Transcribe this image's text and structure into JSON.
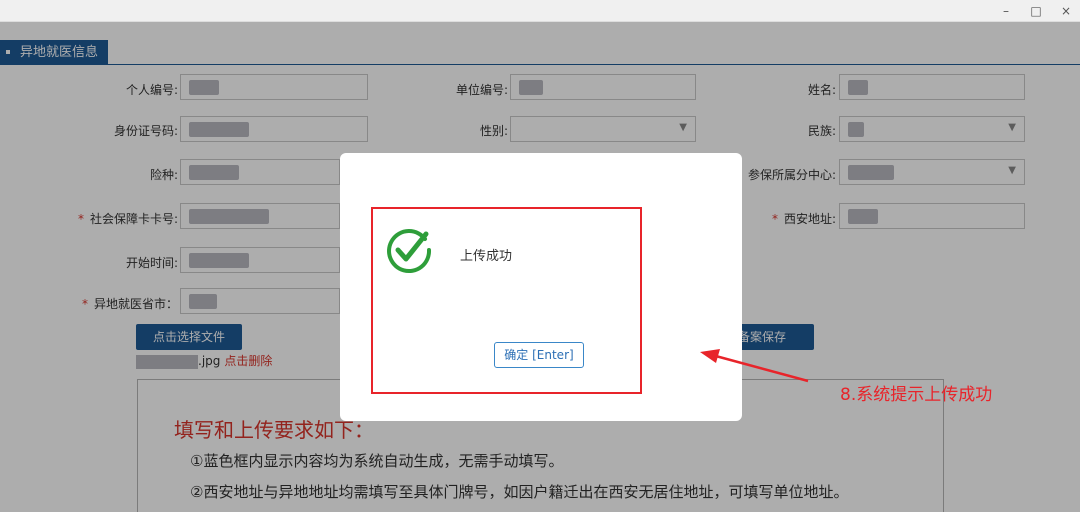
{
  "window": {
    "min": "–",
    "max": "□",
    "close": "×"
  },
  "section": {
    "title": "异地就医信息"
  },
  "form": {
    "personal_no": "个人编号:",
    "unit_no": "单位编号:",
    "name": "姓名:",
    "id_no": "身份证号码:",
    "gender": "性别:",
    "ethnicity": "民族:",
    "insurance_type": "险种:",
    "center": "参保所属分中心:",
    "ss_card": "社会保障卡卡号:",
    "xian_addr": "西安地址:",
    "start_time": "开始时间:",
    "remote_city": "异地就医省市：",
    "required_mark": "*"
  },
  "buttons": {
    "choose_file": "点击选择文件",
    "save": "备案保存"
  },
  "file": {
    "ext": ".jpg",
    "delete": "点击删除"
  },
  "requirements": {
    "title": "填写和上传要求如下：",
    "items": [
      "①蓝色框内显示内容均为系统自动生成，无需手动填写。",
      "②西安地址与异地地址均需填写至具体门牌号，如因户籍迁出在西安无居住地址，可填写单位地址。"
    ]
  },
  "modal": {
    "message": "上传成功",
    "ok_button": "确定 [Enter]",
    "icon": "check-circle-icon",
    "icon_color": "#2e9e3a"
  },
  "annotation": {
    "text": "8.系统提示上传成功",
    "color": "#e8242a"
  }
}
